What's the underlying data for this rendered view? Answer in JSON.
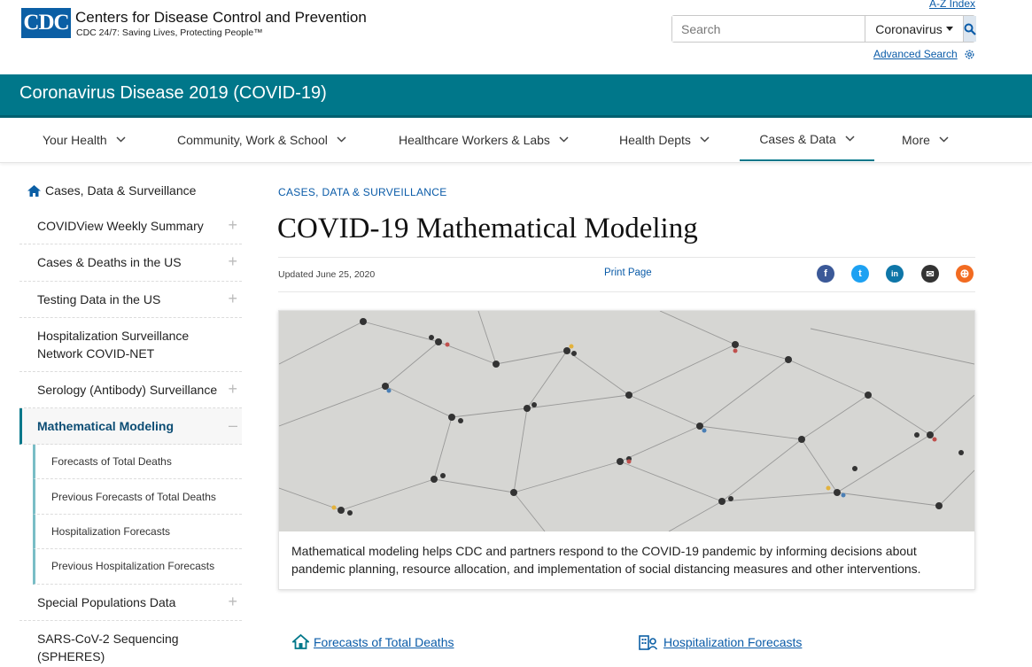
{
  "header": {
    "logo_text": "CDC",
    "org_name": "Centers for Disease Control and Prevention",
    "tagline": "CDC 24/7: Saving Lives, Protecting People™",
    "az_index": "A-Z Index",
    "search_placeholder": "Search",
    "search_scope": "Coronavirus",
    "advanced_search": "Advanced Search",
    "icons": {
      "search": "search-icon",
      "settings": "gear-icon"
    }
  },
  "banner": {
    "title": "Coronavirus Disease 2019 (COVID-19)"
  },
  "nav": {
    "items": [
      {
        "label": "Your Health"
      },
      {
        "label": "Community, Work & School"
      },
      {
        "label": "Healthcare Workers & Labs"
      },
      {
        "label": "Health Depts"
      },
      {
        "label": "Cases & Data",
        "active": true
      },
      {
        "label": "More"
      }
    ]
  },
  "sidebar": {
    "home": "Cases, Data & Surveillance",
    "items": [
      {
        "label": "COVIDView Weekly Summary",
        "toggle": "+"
      },
      {
        "label": "Cases & Deaths in the US",
        "toggle": "+"
      },
      {
        "label": "Testing Data in the US",
        "toggle": "+"
      },
      {
        "label": "Hospitalization Surveillance Network COVID-NET",
        "line1": "Hospitalization Surveillance",
        "line2": "Network COVID-NET"
      },
      {
        "label": "Serology (Antibody) Surveillance",
        "toggle": "+"
      },
      {
        "label": "Mathematical Modeling",
        "toggle": "–",
        "active": true
      },
      {
        "label": "Special Populations Data",
        "toggle": "+"
      },
      {
        "label": "SARS-CoV-2 Sequencing (SPHERES)",
        "line1": "SARS-CoV-2 Sequencing",
        "line2": "(SPHERES)"
      }
    ],
    "subitems": [
      {
        "label": "Forecasts of Total Deaths"
      },
      {
        "label": "Previous Forecasts of Total Deaths"
      },
      {
        "label": "Hospitalization Forecasts"
      },
      {
        "label": "Previous Hospitalization Forecasts"
      }
    ]
  },
  "main": {
    "breadcrumb": "CASES, DATA & SURVEILLANCE",
    "title": "COVID-19 Mathematical Modeling",
    "updated": "Updated June 25, 2020",
    "print": "Print Page",
    "share": [
      {
        "name": "facebook-icon",
        "color": "#3b5998",
        "glyph": "f"
      },
      {
        "name": "twitter-icon",
        "color": "#1da1f2",
        "glyph": "t"
      },
      {
        "name": "linkedin-icon",
        "color": "#0e76a8",
        "glyph": "in"
      },
      {
        "name": "email-icon",
        "color": "#333333",
        "glyph": "✉"
      },
      {
        "name": "syndicate-icon",
        "color": "#f26b21",
        "glyph": "⊕"
      }
    ],
    "caption": "Mathematical modeling helps CDC and partners respond to the COVID-19 pandemic by informing decisions about pandemic planning, resource allocation, and implementation of social distancing measures and other interventions.",
    "links": [
      {
        "label": "Forecasts of Total Deaths",
        "icon": "home-icon"
      },
      {
        "label": "Hospitalization Forecasts",
        "icon": "hospital-icon"
      }
    ]
  },
  "colors": {
    "teal": "#00778a",
    "link": "#0a5ba8",
    "cdc_blue": "#0b5fa5"
  }
}
